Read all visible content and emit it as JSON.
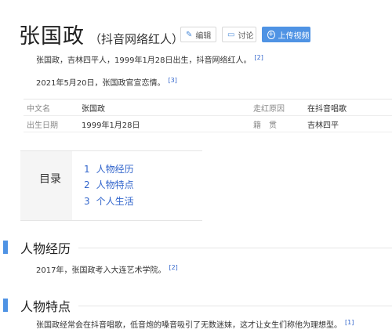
{
  "header": {
    "title": "张国政",
    "subtitle": "（抖音网络红人）",
    "edit_label": "编辑",
    "discuss_label": "讨论",
    "upload_label": "上传视频"
  },
  "summary": [
    {
      "text": "张国政，吉林四平人，1999年1月28日出生，抖音网络红人。",
      "ref": "[2]"
    },
    {
      "text": "2021年5月20日，张国政官宣恋情。",
      "ref": "[3]"
    }
  ],
  "infobox": {
    "rows": [
      {
        "k1": "中文名",
        "v1": "张国政",
        "k2": "走红原因",
        "v2": "在抖音唱歌"
      },
      {
        "k1": "出生日期",
        "v1": "1999年1月28日",
        "k2": "籍　贯",
        "v2": "吉林四平"
      }
    ]
  },
  "toc": {
    "title": "目录",
    "items": [
      {
        "num": "1",
        "label": "人物经历"
      },
      {
        "num": "2",
        "label": "人物特点"
      },
      {
        "num": "3",
        "label": "个人生活"
      }
    ]
  },
  "sections": [
    {
      "heading": "人物经历",
      "text": "2017年，张国政考入大连艺术学院。",
      "ref": "[2]"
    },
    {
      "heading": "人物特点",
      "text": "张国政经常会在抖音唱歌，低音炮的嗓音吸引了无数迷妹，这才让女生们称他为理想型。",
      "ref": "[1]"
    }
  ],
  "colors": {
    "accent": "#4f93e4",
    "link": "#3366cc"
  }
}
